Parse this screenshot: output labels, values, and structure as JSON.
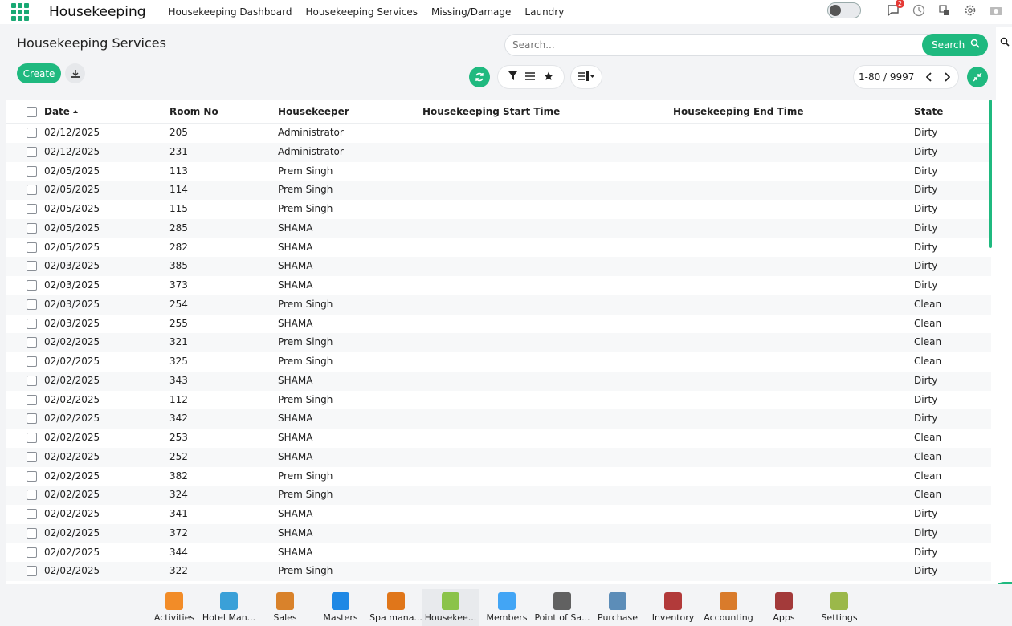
{
  "app": {
    "title": "Housekeeping"
  },
  "nav": {
    "items": [
      "Housekeeping Dashboard",
      "Housekeeping Services",
      "Missing/Damage",
      "Laundry"
    ]
  },
  "topbar": {
    "notification_count": "2"
  },
  "page": {
    "title": "Housekeeping Services"
  },
  "search": {
    "placeholder": "Search...",
    "button_label": "Search"
  },
  "toolbar": {
    "create_label": "Create"
  },
  "pager": {
    "value": "1-80 / 9997"
  },
  "table": {
    "columns": [
      "Date",
      "Room No",
      "Housekeeper",
      "Housekeeping Start Time",
      "Housekeeping End Time",
      "State"
    ],
    "rows": [
      {
        "date": "02/12/2025",
        "room": "205",
        "housekeeper": "Administrator",
        "start": "",
        "end": "",
        "state": "Dirty"
      },
      {
        "date": "02/12/2025",
        "room": "231",
        "housekeeper": "Administrator",
        "start": "",
        "end": "",
        "state": "Dirty"
      },
      {
        "date": "02/05/2025",
        "room": "113",
        "housekeeper": "Prem Singh",
        "start": "",
        "end": "",
        "state": "Dirty"
      },
      {
        "date": "02/05/2025",
        "room": "114",
        "housekeeper": "Prem Singh",
        "start": "",
        "end": "",
        "state": "Dirty"
      },
      {
        "date": "02/05/2025",
        "room": "115",
        "housekeeper": "Prem Singh",
        "start": "",
        "end": "",
        "state": "Dirty"
      },
      {
        "date": "02/05/2025",
        "room": "285",
        "housekeeper": "SHAMA",
        "start": "",
        "end": "",
        "state": "Dirty"
      },
      {
        "date": "02/05/2025",
        "room": "282",
        "housekeeper": "SHAMA",
        "start": "",
        "end": "",
        "state": "Dirty"
      },
      {
        "date": "02/03/2025",
        "room": "385",
        "housekeeper": "SHAMA",
        "start": "",
        "end": "",
        "state": "Dirty"
      },
      {
        "date": "02/03/2025",
        "room": "373",
        "housekeeper": "SHAMA",
        "start": "",
        "end": "",
        "state": "Dirty"
      },
      {
        "date": "02/03/2025",
        "room": "254",
        "housekeeper": "Prem Singh",
        "start": "",
        "end": "",
        "state": "Clean"
      },
      {
        "date": "02/03/2025",
        "room": "255",
        "housekeeper": "SHAMA",
        "start": "",
        "end": "",
        "state": "Clean"
      },
      {
        "date": "02/02/2025",
        "room": "321",
        "housekeeper": "Prem Singh",
        "start": "",
        "end": "",
        "state": "Clean"
      },
      {
        "date": "02/02/2025",
        "room": "325",
        "housekeeper": "Prem Singh",
        "start": "",
        "end": "",
        "state": "Clean"
      },
      {
        "date": "02/02/2025",
        "room": "343",
        "housekeeper": "SHAMA",
        "start": "",
        "end": "",
        "state": "Dirty"
      },
      {
        "date": "02/02/2025",
        "room": "112",
        "housekeeper": "Prem Singh",
        "start": "",
        "end": "",
        "state": "Dirty"
      },
      {
        "date": "02/02/2025",
        "room": "342",
        "housekeeper": "SHAMA",
        "start": "",
        "end": "",
        "state": "Dirty"
      },
      {
        "date": "02/02/2025",
        "room": "253",
        "housekeeper": "SHAMA",
        "start": "",
        "end": "",
        "state": "Clean"
      },
      {
        "date": "02/02/2025",
        "room": "252",
        "housekeeper": "SHAMA",
        "start": "",
        "end": "",
        "state": "Clean"
      },
      {
        "date": "02/02/2025",
        "room": "382",
        "housekeeper": "Prem Singh",
        "start": "",
        "end": "",
        "state": "Clean"
      },
      {
        "date": "02/02/2025",
        "room": "324",
        "housekeeper": "Prem Singh",
        "start": "",
        "end": "",
        "state": "Clean"
      },
      {
        "date": "02/02/2025",
        "room": "341",
        "housekeeper": "SHAMA",
        "start": "",
        "end": "",
        "state": "Dirty"
      },
      {
        "date": "02/02/2025",
        "room": "372",
        "housekeeper": "SHAMA",
        "start": "",
        "end": "",
        "state": "Dirty"
      },
      {
        "date": "02/02/2025",
        "room": "344",
        "housekeeper": "SHAMA",
        "start": "",
        "end": "",
        "state": "Dirty"
      },
      {
        "date": "02/02/2025",
        "room": "322",
        "housekeeper": "Prem Singh",
        "start": "",
        "end": "",
        "state": "Dirty"
      }
    ]
  },
  "dock": {
    "items": [
      {
        "label": "Activities",
        "icon": "activities-icon",
        "color": "#f28c28"
      },
      {
        "label": "Hotel Man...",
        "icon": "hotel-icon",
        "color": "#3aa0d8"
      },
      {
        "label": "Sales",
        "icon": "sales-icon",
        "color": "#d9822b"
      },
      {
        "label": "Masters",
        "icon": "masters-icon",
        "color": "#1e88e5"
      },
      {
        "label": "Spa mana...",
        "icon": "spa-icon",
        "color": "#e0761a"
      },
      {
        "label": "Housekee...",
        "icon": "housekeeping-icon",
        "color": "#8bc34a"
      },
      {
        "label": "Members",
        "icon": "members-icon",
        "color": "#42a5f5"
      },
      {
        "label": "Point of Sa...",
        "icon": "pos-icon",
        "color": "#616161"
      },
      {
        "label": "Purchase",
        "icon": "purchase-icon",
        "color": "#5c8db8"
      },
      {
        "label": "Inventory",
        "icon": "inventory-icon",
        "color": "#b23a3a"
      },
      {
        "label": "Accounting",
        "icon": "accounting-icon",
        "color": "#d97b2b"
      },
      {
        "label": "Apps",
        "icon": "apps-icon",
        "color": "#a33a3a"
      },
      {
        "label": "Settings",
        "icon": "settings-icon",
        "color": "#9bb84a"
      }
    ]
  },
  "colors": {
    "accent": "#1fb97f",
    "badge": "#e53935"
  }
}
